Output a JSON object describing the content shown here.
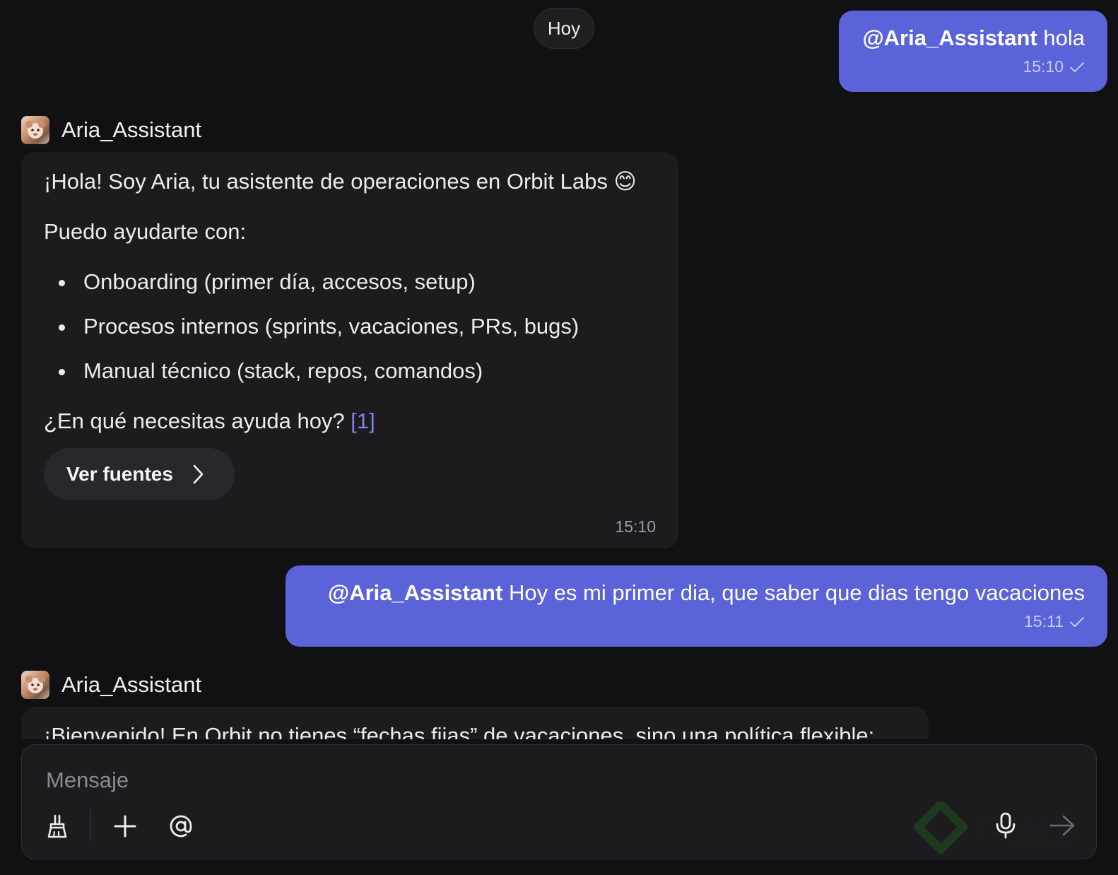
{
  "date_separator": "Hoy",
  "messages": [
    {
      "mention": "@Aria_Assistant",
      "text": " hola",
      "time": "15:10"
    },
    {
      "sender": "Aria_Assistant",
      "greeting": "¡Hola! Soy Aria, tu asistente de operaciones en Orbit Labs 😊",
      "intro": "Puedo ayudarte con:",
      "items": [
        "Onboarding (primer día, accesos, setup)",
        "Procesos internos (sprints, vacaciones, PRs, bugs)",
        "Manual técnico (stack, repos, comandos)"
      ],
      "question": "¿En qué necesitas ayuda hoy? ",
      "citation": "[1]",
      "sources_label": "Ver fuentes",
      "time": "15:10"
    },
    {
      "mention": "@Aria_Assistant",
      "text": " Hoy es mi primer dia, que saber que dias tengo vacaciones",
      "time": "15:11"
    },
    {
      "sender": "Aria_Assistant",
      "partial_text": "¡Bienvenido! En Orbit no tienes “fechas fijas” de vacaciones, sino una política flexible:"
    }
  ],
  "composer": {
    "placeholder": "Mensaje",
    "icons": [
      "broom-icon",
      "plus-icon",
      "at-icon",
      "microphone-icon",
      "send-arrow-icon"
    ]
  },
  "watermark": "Platzi"
}
